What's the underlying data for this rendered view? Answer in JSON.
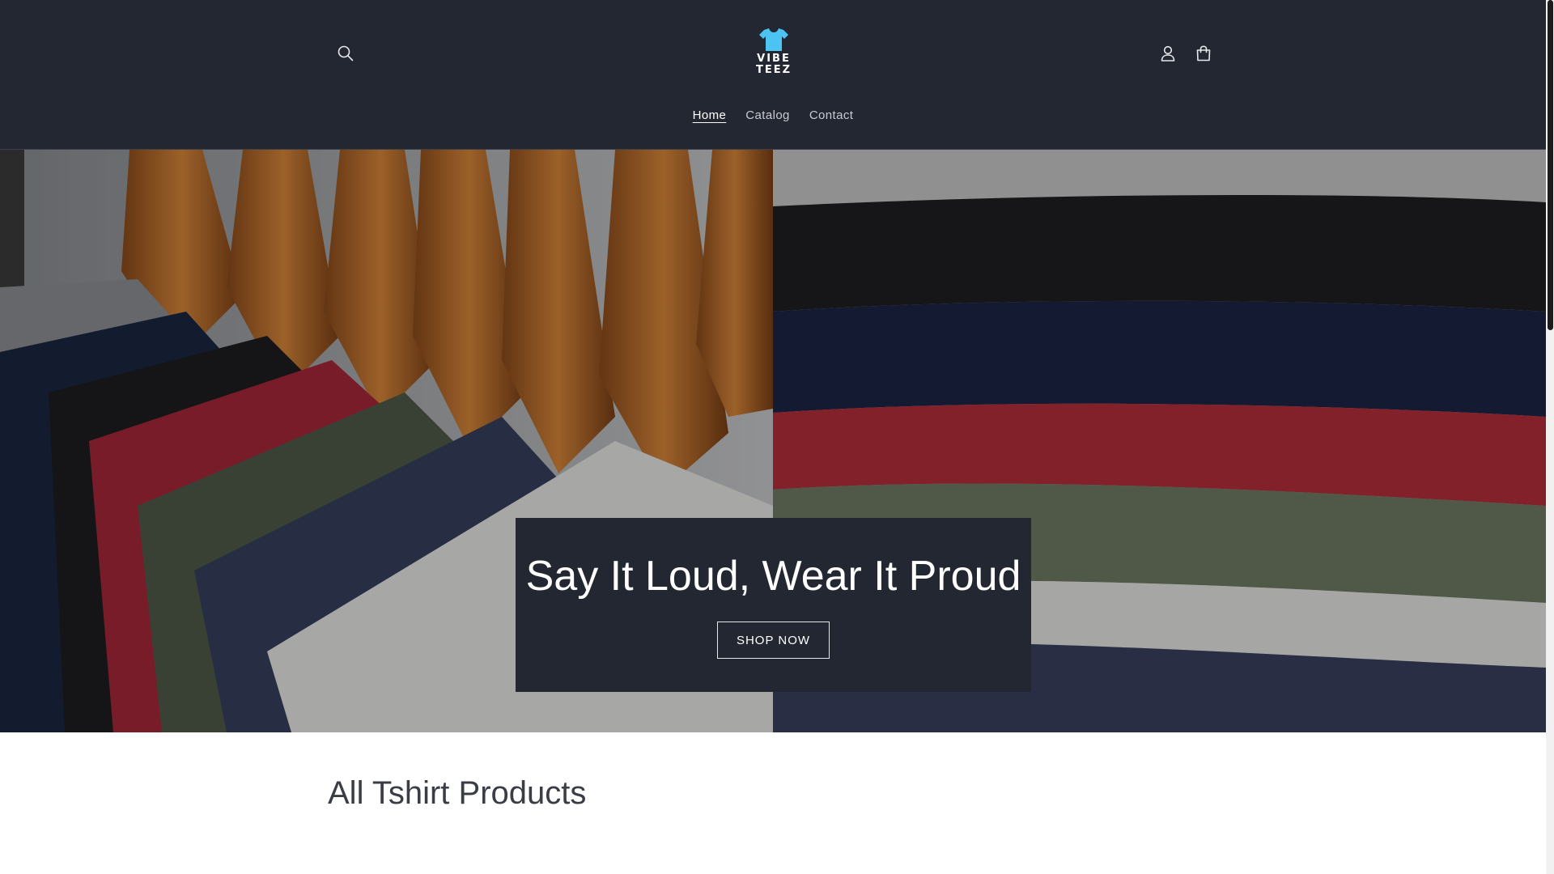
{
  "header": {
    "logo": {
      "line1": "VIBE",
      "line2": "TEEZ"
    },
    "search_icon": "search-icon",
    "account_icon": "account-icon",
    "cart_icon": "cart-icon"
  },
  "nav": {
    "items": [
      {
        "label": "Home",
        "active": true
      },
      {
        "label": "Catalog",
        "active": false
      },
      {
        "label": "Contact",
        "active": false
      }
    ]
  },
  "hero": {
    "heading": "Say It Loud, Wear It Proud",
    "button_label": "SHOP NOW"
  },
  "products": {
    "title": "All Tshirt Products"
  },
  "colors": {
    "header_bg": "#232732",
    "logo_shirt": "#4cc3f2",
    "text_light": "#ffffff"
  }
}
